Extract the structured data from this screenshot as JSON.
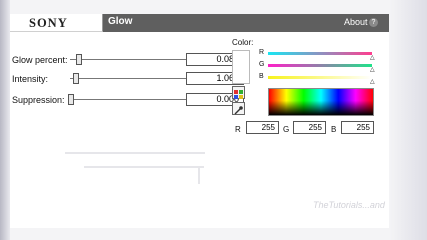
{
  "header": {
    "brand": "SONY",
    "effect_title": "Glow",
    "about_label": "About",
    "help_glyph": "?"
  },
  "params": [
    {
      "label": "Glow percent:",
      "value": "0.083"
    },
    {
      "label": "Intensity:",
      "value": "1.060"
    },
    {
      "label": "Suppression:",
      "value": "0.000"
    }
  ],
  "color": {
    "label": "Color:",
    "channels": [
      "R",
      "G",
      "B"
    ],
    "r_label": "R",
    "r_value": "255",
    "g_label": "G",
    "g_value": "255",
    "b_label": "B",
    "b_value": "255"
  },
  "watermark": "TheTutorials...and",
  "icons": {
    "palette": "palette-icon",
    "eyedropper": "eyedropper-icon",
    "help": "help-icon"
  },
  "colors": {
    "header": "#5f5f5f",
    "red_channel": "#ff3e8f",
    "green_channel": "#1fe38a",
    "blue_channel": "#f7f31b"
  }
}
